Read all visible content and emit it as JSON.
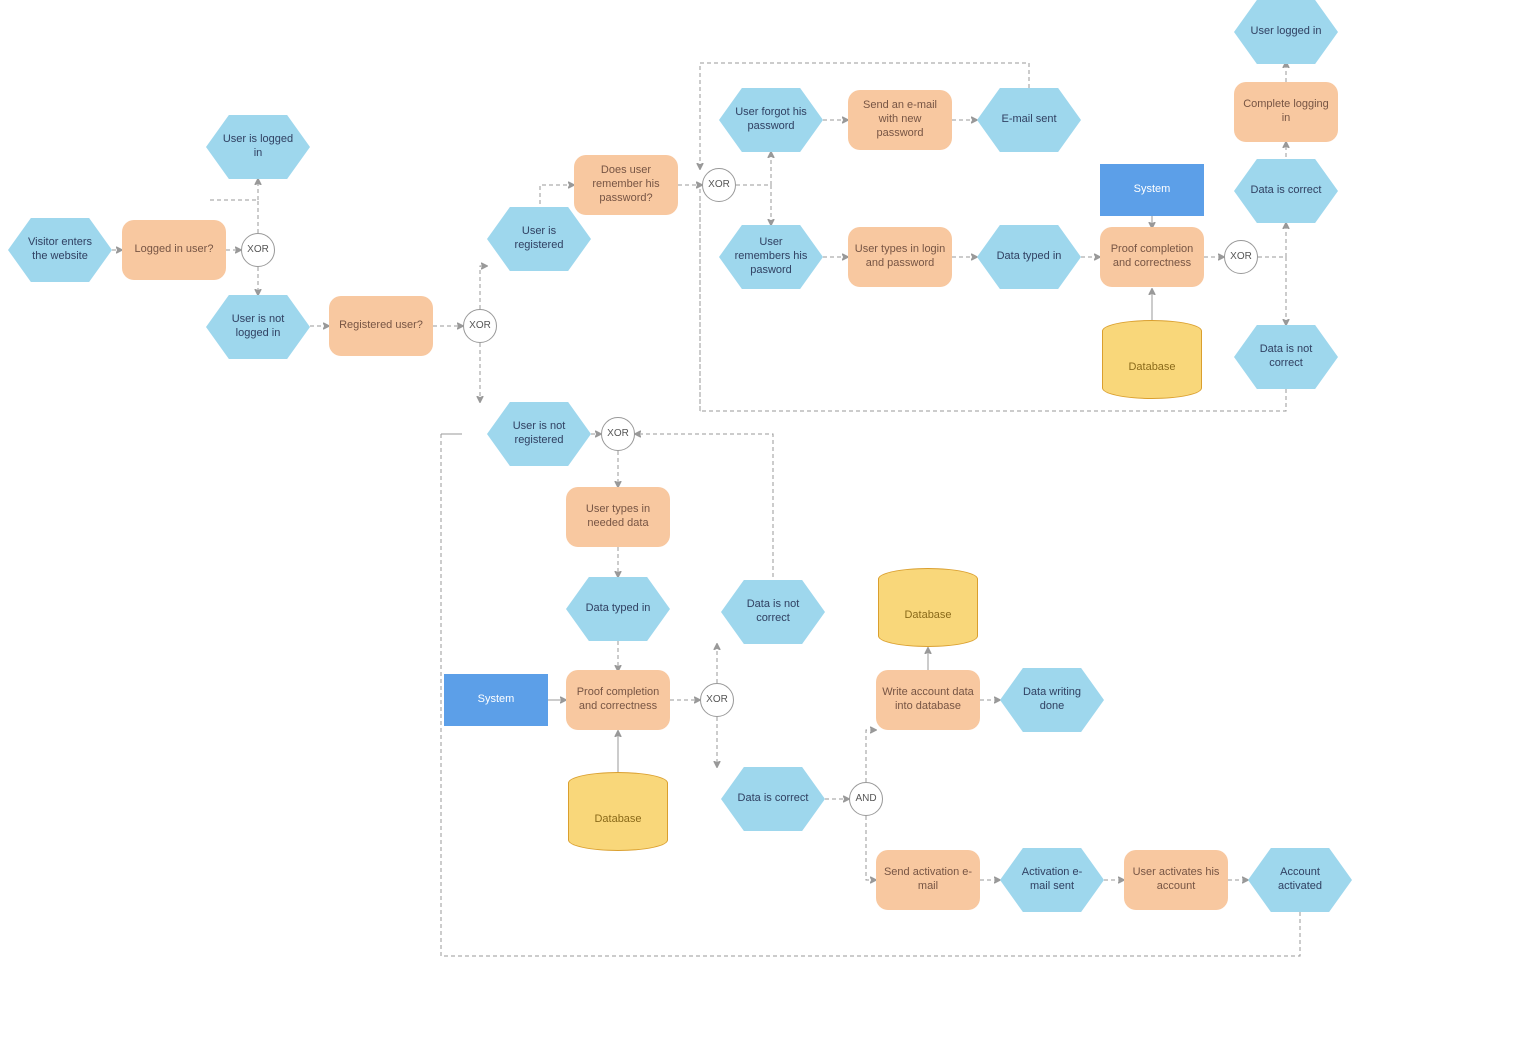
{
  "gates": {
    "xor": "XOR",
    "and": "AND"
  },
  "nodes": {
    "visitor_enters": "Visitor enters the website",
    "logged_in_q": "Logged in user?",
    "user_is_logged_in": "User is logged in",
    "user_not_logged_in": "User is not logged in",
    "registered_q": "Registered user?",
    "user_registered": "User is registered",
    "user_not_registered": "User is not registered",
    "remember_pw_q": "Does user remember his password?",
    "forgot_pw": "User forgot his password",
    "send_pw_email": "Send an e-mail with new password",
    "email_sent": "E-mail sent",
    "remembers_pw": "User remembers his pasword",
    "types_login": "User types in login and password",
    "data_typed_in_1": "Data typed in",
    "proof_1": "Proof completion and correctness",
    "system_1": "System",
    "database_1": "Database",
    "data_correct_1": "Data is correct",
    "data_not_correct_1": "Data is not correct",
    "complete_login": "Complete logging in",
    "user_logged_in_end": "User logged in",
    "types_needed": "User types in needed data",
    "data_typed_in_2": "Data typed in",
    "system_2": "System",
    "proof_2": "Proof completion and correctness",
    "database_2": "Database",
    "data_correct_2": "Data is correct",
    "data_not_correct_2": "Data is not correct",
    "write_db": "Write account data into database",
    "database_3": "Database",
    "data_writing_done": "Data writing done",
    "send_activation": "Send activation e-mail",
    "activation_sent": "Activation e-mail sent",
    "user_activates": "User activates his account",
    "account_activated": "Account activated"
  }
}
